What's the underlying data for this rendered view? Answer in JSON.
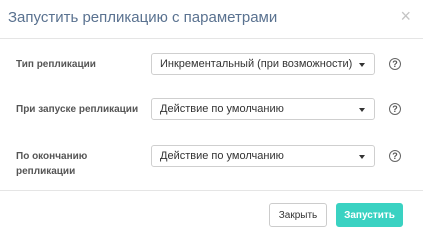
{
  "dialog": {
    "title": "Запустить репликацию с параметрами",
    "close_icon": "×"
  },
  "fields": [
    {
      "label": "Тип репликации",
      "value": "Инкрементальный (при возможности)",
      "help": "?"
    },
    {
      "label": "При запуске репликации",
      "value": "Действие по умолчанию",
      "help": "?"
    },
    {
      "label": "По окончанию репликации",
      "value": "Действие по умолчанию",
      "help": "?"
    }
  ],
  "buttons": {
    "close_label": "Закрыть",
    "run_label": "Запустить"
  },
  "colors": {
    "title": "#5a7290",
    "primary": "#3ad2c2"
  },
  "icons": {
    "close": "close-icon",
    "help": "help-circle-icon",
    "dropdown": "chevron-down-icon"
  }
}
